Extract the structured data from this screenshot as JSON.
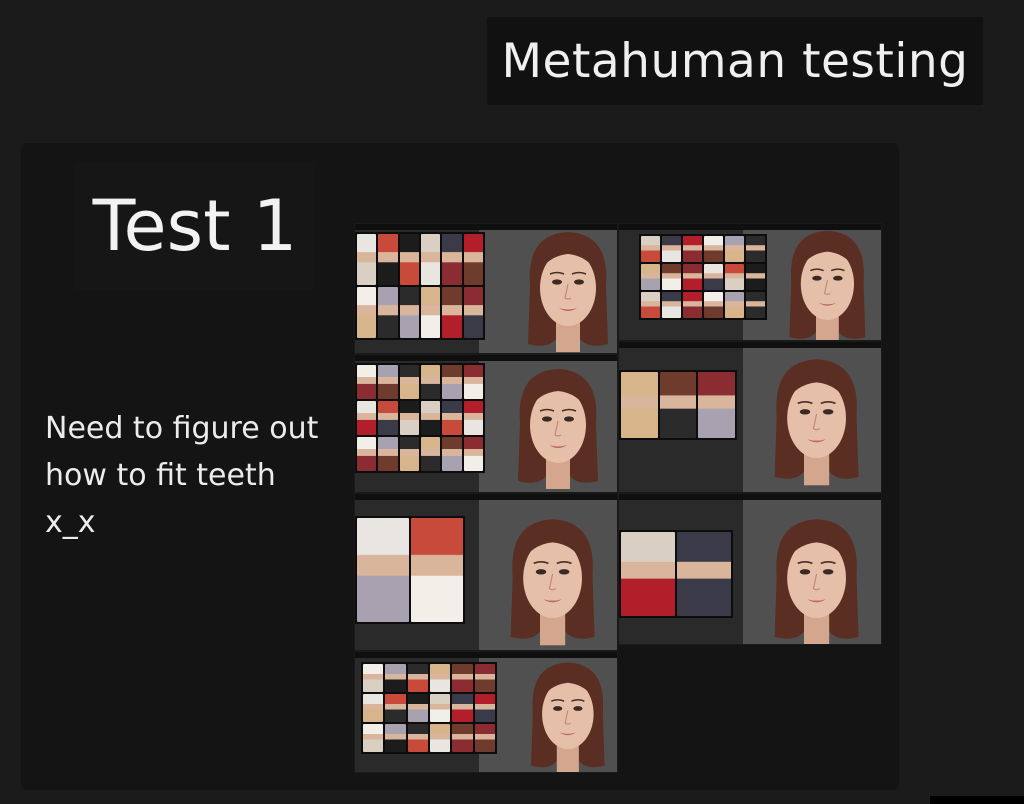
{
  "header": {
    "title": "Metahuman testing"
  },
  "board": {
    "heading": "Test 1",
    "note_lines": [
      "Need to figure out",
      "how to fit teeth",
      "x_x"
    ]
  },
  "screenshots": [
    {
      "name": "screenshot-1-smile"
    },
    {
      "name": "screenshot-2-neutral"
    },
    {
      "name": "screenshot-3-squint"
    },
    {
      "name": "screenshot-4-smirk"
    },
    {
      "name": "screenshot-5-neutral"
    },
    {
      "name": "screenshot-6-smile"
    },
    {
      "name": "screenshot-7-kiss"
    }
  ],
  "colors": {
    "background": "#1b1b1b",
    "board": "#141414",
    "viewport": "#505050",
    "hair": "#5a2e22",
    "skin": "#e6bfa9"
  }
}
